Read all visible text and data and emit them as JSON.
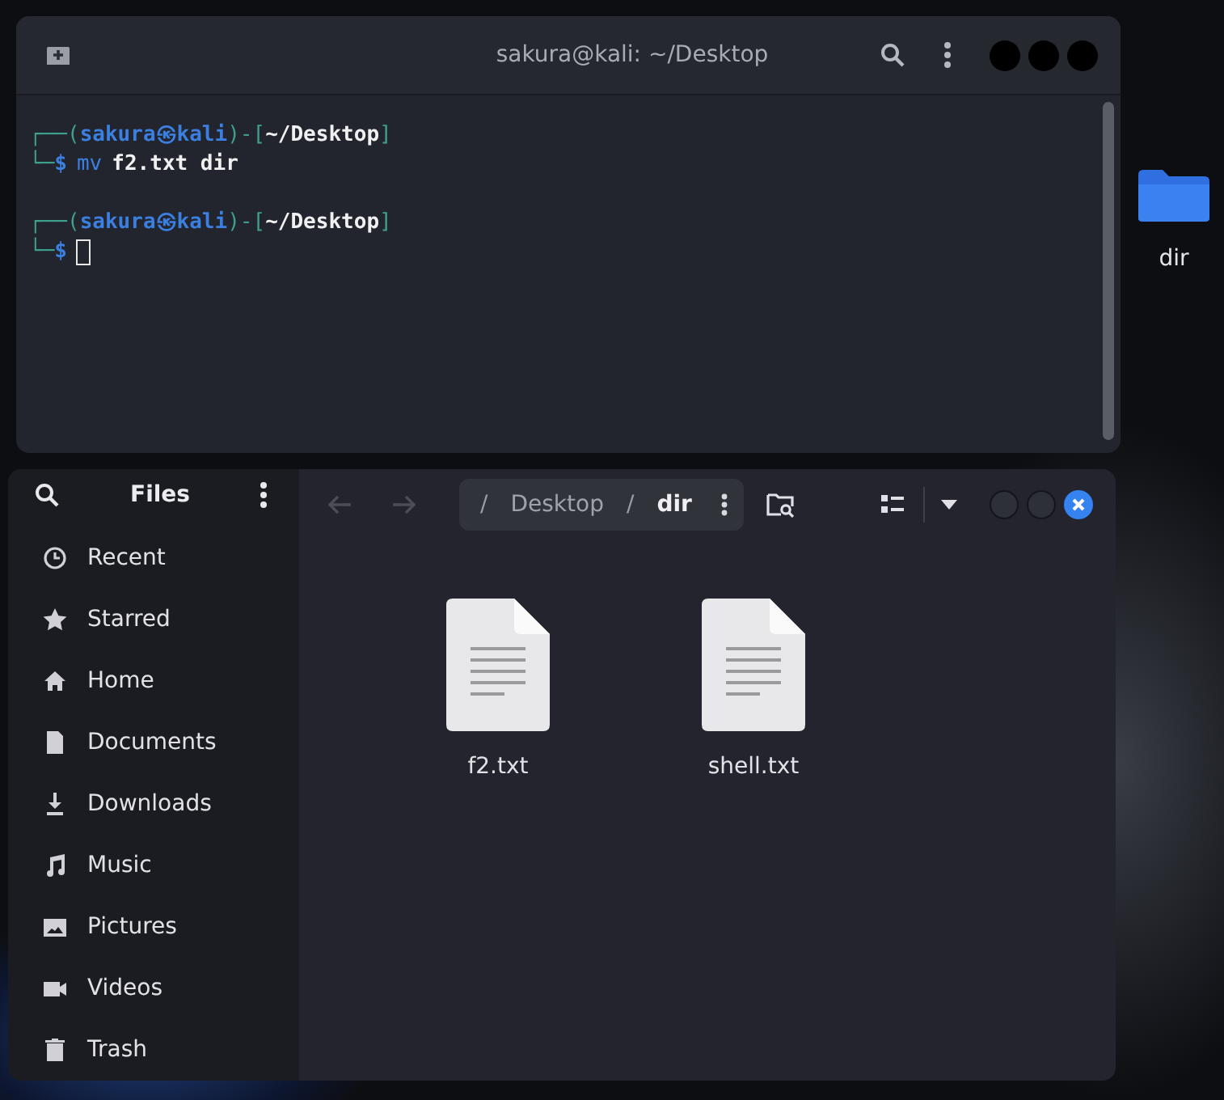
{
  "desktop": {
    "icons": [
      {
        "label": "dir"
      }
    ]
  },
  "terminal": {
    "title": "sakura@kali: ~/Desktop",
    "lines": [
      {
        "kind": "prompt",
        "segments": [
          {
            "kind": "frame",
            "text": "┌──("
          },
          {
            "kind": "user",
            "text": "sakura㉿kali"
          },
          {
            "kind": "frame",
            "text": ")-["
          },
          {
            "kind": "path",
            "text": "~/Desktop"
          },
          {
            "kind": "frame",
            "text": "]"
          }
        ]
      },
      {
        "kind": "command",
        "segments": [
          {
            "kind": "frame",
            "text": "└─"
          },
          {
            "kind": "user",
            "text": "$"
          },
          {
            "kind": "cmd",
            "text": "mv"
          },
          {
            "kind": "arg",
            "text": "f2.txt dir"
          }
        ]
      },
      {
        "kind": "blank"
      },
      {
        "kind": "prompt",
        "segments": [
          {
            "kind": "frame",
            "text": "┌──("
          },
          {
            "kind": "user",
            "text": "sakura㉿kali"
          },
          {
            "kind": "frame",
            "text": ")-["
          },
          {
            "kind": "path",
            "text": "~/Desktop"
          },
          {
            "kind": "frame",
            "text": "]"
          }
        ]
      },
      {
        "kind": "input",
        "segments": [
          {
            "kind": "frame",
            "text": "└─"
          },
          {
            "kind": "user",
            "text": "$"
          }
        ]
      }
    ]
  },
  "files": {
    "title": "Files",
    "path": [
      {
        "kind": "separator",
        "label": "/"
      },
      {
        "kind": "folder",
        "label": "Desktop",
        "selected": false
      },
      {
        "kind": "separator",
        "label": "/"
      },
      {
        "kind": "folder",
        "label": "dir",
        "selected": true
      }
    ],
    "sidebar": {
      "items": [
        {
          "label": "Recent"
        },
        {
          "label": "Starred"
        },
        {
          "label": "Home"
        },
        {
          "label": "Documents"
        },
        {
          "label": "Downloads"
        },
        {
          "label": "Music"
        },
        {
          "label": "Pictures"
        },
        {
          "label": "Videos"
        },
        {
          "label": "Trash"
        }
      ]
    },
    "items": [
      {
        "name": "f2.txt"
      },
      {
        "name": "shell.txt"
      }
    ]
  }
}
